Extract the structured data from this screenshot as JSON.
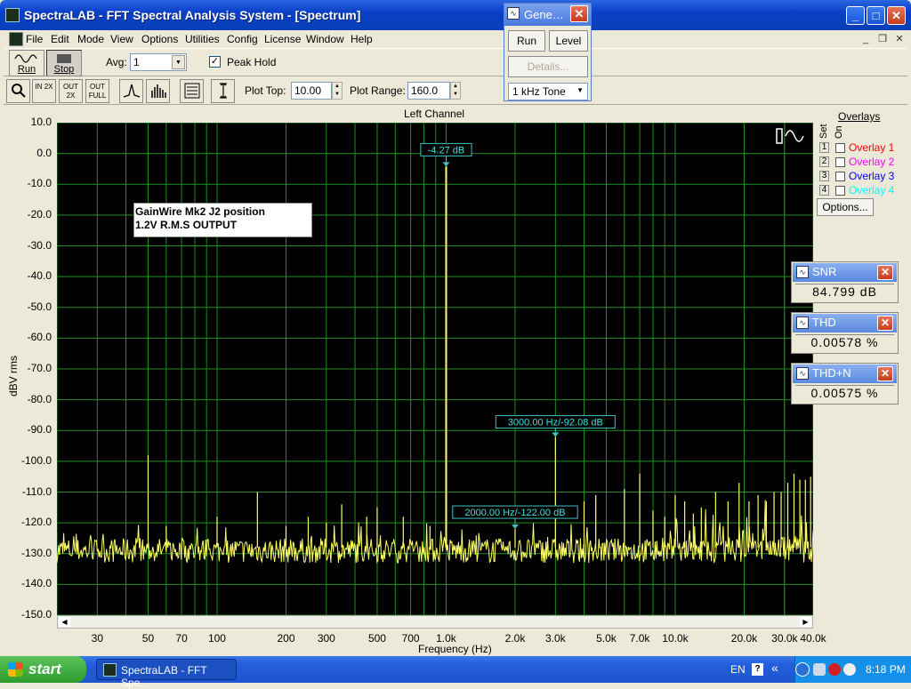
{
  "window": {
    "title": "SpectraLAB - FFT Spectral Analysis System - [Spectrum]"
  },
  "menu": [
    "File",
    "Edit",
    "Mode",
    "View",
    "Options",
    "Utilities",
    "Config",
    "License",
    "Window",
    "Help"
  ],
  "toolbar": {
    "run_label": "Run",
    "stop_label": "Stop",
    "avg_label": "Avg:",
    "avg_value": "1",
    "peak_hold_label": "Peak Hold",
    "peak_hold_checked": true,
    "plot_top_label": "Plot Top:",
    "plot_top_value": "10.00",
    "plot_range_label": "Plot Range:",
    "plot_range_value": "160.0",
    "zoom_in_label": "IN 2X",
    "zoom_out_label": "OUT 2X",
    "zoom_full_label": "OUT FULL"
  },
  "generator": {
    "title": "Gene…",
    "run_label": "Run",
    "level_label": "Level",
    "details_label": "Details...",
    "signal_value": "1 kHz Tone"
  },
  "overlays": {
    "header": "Overlays",
    "set_label": "Set",
    "on_label": "On",
    "items": [
      {
        "num": "1",
        "label": "Overlay 1",
        "color": "#ff0000"
      },
      {
        "num": "2",
        "label": "Overlay 2",
        "color": "#ff00ff"
      },
      {
        "num": "3",
        "label": "Overlay 3",
        "color": "#0000ff"
      },
      {
        "num": "4",
        "label": "Overlay 4",
        "color": "#00ffff"
      }
    ],
    "options_label": "Options..."
  },
  "meters": [
    {
      "name": "SNR",
      "value": "84.799 dB"
    },
    {
      "name": "THD",
      "value": "0.00578 %"
    },
    {
      "name": "THD+N",
      "value": "0.00575 %"
    }
  ],
  "chart_data": {
    "type": "line",
    "title": "Left Channel",
    "xlabel": "Frequency (Hz)",
    "ylabel": "dBV rms",
    "x_scale": "log",
    "xlim": [
      20,
      40000
    ],
    "ylim": [
      -150,
      10
    ],
    "grid": true,
    "background": "#000000",
    "grid_color": "#1f8f1f",
    "trace_color": "#ffff66",
    "y_ticks": [
      "10.0",
      "0.0",
      "-10.0",
      "-20.0",
      "-30.0",
      "-40.0",
      "-50.0",
      "-60.0",
      "-70.0",
      "-80.0",
      "-90.0",
      "-100.0",
      "-110.0",
      "-120.0",
      "-130.0",
      "-140.0",
      "-150.0"
    ],
    "x_ticks": [
      {
        "label": "30",
        "value": 30
      },
      {
        "label": "50",
        "value": 50
      },
      {
        "label": "70",
        "value": 70
      },
      {
        "label": "100",
        "value": 100
      },
      {
        "label": "200",
        "value": 200
      },
      {
        "label": "300",
        "value": 300
      },
      {
        "label": "500",
        "value": 500
      },
      {
        "label": "700",
        "value": 700
      },
      {
        "label": "1.0k",
        "value": 1000
      },
      {
        "label": "2.0k",
        "value": 2000
      },
      {
        "label": "3.0k",
        "value": 3000
      },
      {
        "label": "5.0k",
        "value": 5000
      },
      {
        "label": "7.0k",
        "value": 7000
      },
      {
        "label": "10.0k",
        "value": 10000
      },
      {
        "label": "20.0k",
        "value": 20000
      },
      {
        "label": "30.0k",
        "value": 30000
      },
      {
        "label": "40.0k",
        "value": 40000
      }
    ],
    "noise_floor": -128,
    "peaks": [
      {
        "x": 50,
        "y": -98
      },
      {
        "x": 60,
        "y": -121
      },
      {
        "x": 100,
        "y": -118
      },
      {
        "x": 150,
        "y": -110
      },
      {
        "x": 200,
        "y": -121
      },
      {
        "x": 250,
        "y": -118
      },
      {
        "x": 300,
        "y": -120
      },
      {
        "x": 350,
        "y": -114
      },
      {
        "x": 450,
        "y": -118
      },
      {
        "x": 500,
        "y": -115
      },
      {
        "x": 650,
        "y": -118
      },
      {
        "x": 850,
        "y": -121
      },
      {
        "x": 1000,
        "y": -4.27
      },
      {
        "x": 2000,
        "y": -122
      },
      {
        "x": 3000,
        "y": -92.08
      },
      {
        "x": 4000,
        "y": -113
      },
      {
        "x": 4500,
        "y": -111
      },
      {
        "x": 6000,
        "y": -109
      },
      {
        "x": 7000,
        "y": -104
      },
      {
        "x": 8000,
        "y": -116
      },
      {
        "x": 9000,
        "y": -118
      },
      {
        "x": 10000,
        "y": -111
      },
      {
        "x": 11000,
        "y": -113
      },
      {
        "x": 12000,
        "y": -117
      },
      {
        "x": 13000,
        "y": -115
      },
      {
        "x": 15000,
        "y": -110
      },
      {
        "x": 17000,
        "y": -113
      },
      {
        "x": 19000,
        "y": -107
      },
      {
        "x": 21000,
        "y": -113
      },
      {
        "x": 23000,
        "y": -111
      },
      {
        "x": 25000,
        "y": -113
      },
      {
        "x": 27000,
        "y": -110
      },
      {
        "x": 29000,
        "y": -110
      },
      {
        "x": 31000,
        "y": -107
      },
      {
        "x": 33000,
        "y": -104
      },
      {
        "x": 35000,
        "y": -106
      },
      {
        "x": 37000,
        "y": -106
      },
      {
        "x": 39000,
        "y": -105
      }
    ],
    "markers": [
      {
        "x": 1000,
        "y": -4.27,
        "label": "-4.27 dB"
      },
      {
        "x": 3000,
        "y": -92.08,
        "label": "3000.00 Hz/-92.08 dB"
      },
      {
        "x": 2000,
        "y": -122.0,
        "label": "2000.00 Hz/-122.00 dB"
      }
    ],
    "annotation": [
      "GainWire Mk2 J2 position",
      "1.2V R.M.S OUTPUT"
    ]
  },
  "taskbar": {
    "start_label": "start",
    "task_label": "SpectraLAB - FFT Spe...",
    "lang": "EN",
    "clock": "8:18 PM"
  }
}
